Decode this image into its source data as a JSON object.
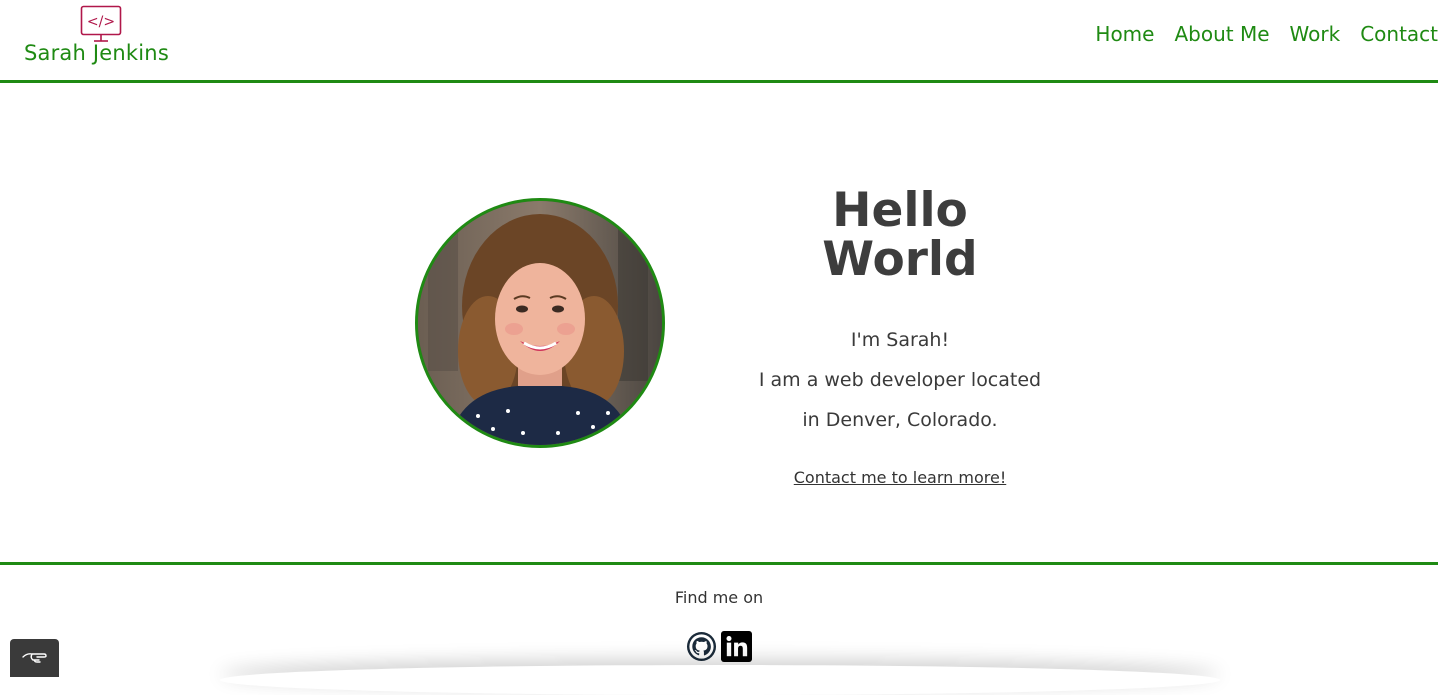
{
  "header": {
    "brand_name": "Sarah Jenkins",
    "brand_icon": "code-monitor-icon",
    "nav": [
      {
        "label": "Home"
      },
      {
        "label": "About Me"
      },
      {
        "label": "Work"
      },
      {
        "label": "Contact"
      }
    ]
  },
  "hero": {
    "title_line1": "Hello",
    "title_line2": "World",
    "intro": "I'm Sarah!",
    "line2": "I am a web developer located",
    "line3": "in Denver, Colorado.",
    "cta": "Contact me to learn more!"
  },
  "footer": {
    "label": "Find me on",
    "socials": [
      {
        "icon": "github-icon"
      },
      {
        "icon": "linkedin-icon"
      }
    ]
  },
  "widget": {
    "icon": "hand-pointer-icon"
  },
  "colors": {
    "accent": "#1f8a13",
    "brand_icon": "#b0174a",
    "text": "#3c3c3c"
  }
}
